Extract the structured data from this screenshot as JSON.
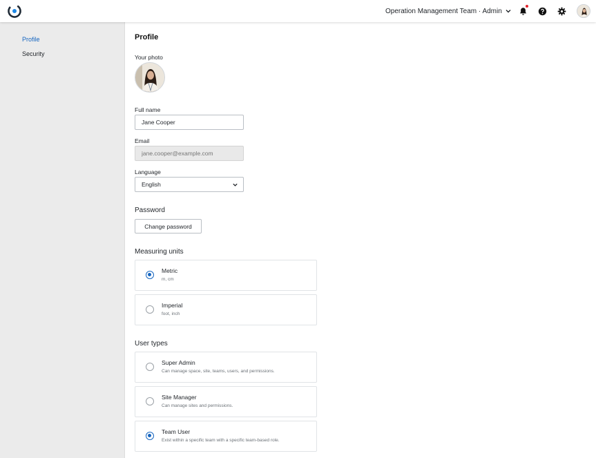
{
  "header": {
    "team_selector": "Operation Management Team · Admin",
    "icons": [
      "logo-icon",
      "chevron-down-icon",
      "bell-icon",
      "help-icon",
      "gear-icon",
      "avatar"
    ],
    "notification_dot_color": "#e5222b"
  },
  "sidebar": {
    "items": [
      {
        "label": "Profile",
        "active": true
      },
      {
        "label": "Security",
        "active": false
      }
    ]
  },
  "profile": {
    "title": "Profile",
    "photo_label": "Your photo",
    "full_name_label": "Full name",
    "full_name_value": "Jane Cooper",
    "email_label": "Email",
    "email_placeholder": "jane.cooper@example.com",
    "language_label": "Language",
    "language_value": "English",
    "password_title": "Password",
    "change_password_label": "Change password",
    "units_title": "Measuring units",
    "units": [
      {
        "title": "Metric",
        "desc": "m, cm",
        "selected": true
      },
      {
        "title": "Imperial",
        "desc": "foot, inch",
        "selected": false
      }
    ],
    "user_types_title": "User types",
    "user_types": [
      {
        "title": "Super Admin",
        "desc": "Can manage space, site, teams, users, and permissions.",
        "selected": false
      },
      {
        "title": "Site Manager",
        "desc": "Can manage sites and permissions.",
        "selected": false
      },
      {
        "title": "Team User",
        "desc": "Exist within a specific team with a specific team-based role.",
        "selected": true
      }
    ]
  },
  "colors": {
    "accent": "#1565c0",
    "sidebar_bg": "#ebebeb"
  }
}
